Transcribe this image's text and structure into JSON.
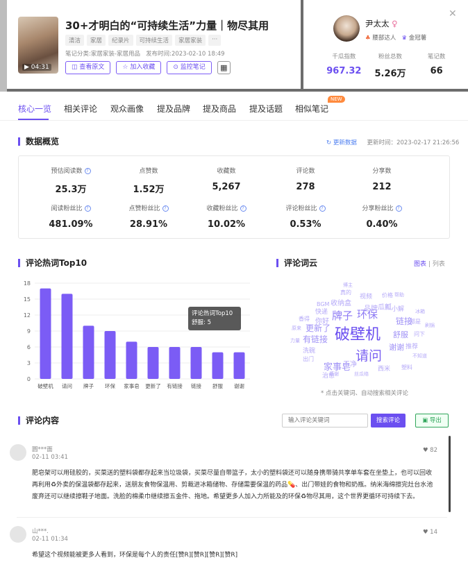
{
  "note": {
    "duration": "04:31",
    "title": "30+才明白的“可持续生活”力量｜物尽其用",
    "tags": [
      "清洁",
      "家居",
      "纪录片",
      "可持续生活",
      "家居家装",
      "···"
    ],
    "category_label": "笔记分类:",
    "category": "家居家装-家居用品",
    "publish_label": "发布时间:",
    "publish_time": "2023-02-10 18:49",
    "actions": [
      "查看原文",
      "加入收藏",
      "监控笔记"
    ],
    "qr_icon": "qr-code-icon"
  },
  "author": {
    "name": "尹太太",
    "gender_icon": "♀",
    "badge1": "腰部达人",
    "badge2": "金冠薯",
    "stats": [
      {
        "label": "千瓜指数",
        "value": "967.32"
      },
      {
        "label": "粉丝总数",
        "value": "5.26万"
      },
      {
        "label": "笔记数",
        "value": "66"
      }
    ]
  },
  "tabs": [
    "核心一览",
    "相关评论",
    "观众画像",
    "提及品牌",
    "提及商品",
    "提及话题",
    "相似笔记"
  ],
  "new_badge": "NEW",
  "overview": {
    "title": "数据概览",
    "refresh": "更新数据",
    "update_label": "更新时间：",
    "update_time": "2023-02-17 21:26:56",
    "row1": [
      {
        "label": "预估阅读数",
        "value": "25.3万",
        "help": true
      },
      {
        "label": "点赞数",
        "value": "1.52万",
        "help": false
      },
      {
        "label": "收藏数",
        "value": "5,267",
        "help": false
      },
      {
        "label": "评论数",
        "value": "278",
        "help": false
      },
      {
        "label": "分享数",
        "value": "212",
        "help": false
      }
    ],
    "row2": [
      {
        "label": "阅读粉丝比",
        "value": "481.09%",
        "help": true
      },
      {
        "label": "点赞粉丝比",
        "value": "28.91%",
        "help": true
      },
      {
        "label": "收藏粉丝比",
        "value": "10.02%",
        "help": true
      },
      {
        "label": "评论粉丝比",
        "value": "0.53%",
        "help": true
      },
      {
        "label": "分享粉丝比",
        "value": "0.40%",
        "help": true
      }
    ]
  },
  "hotwords": {
    "title": "评论热词Top10",
    "tooltip_title": "评论热词Top10",
    "tooltip_value": "舒服: 5"
  },
  "chart_data": {
    "type": "bar",
    "title": "评论热词Top10",
    "categories": [
      "破壁机",
      "请问",
      "牌子",
      "环保",
      "家事皂",
      "更新了",
      "有链接",
      "链接",
      "舒服",
      "谢谢"
    ],
    "values": [
      17,
      16,
      10,
      9,
      7,
      6,
      6,
      6,
      5,
      5
    ],
    "ylim": [
      0,
      18
    ],
    "yticks": [
      0,
      3,
      6,
      9,
      12,
      15,
      18
    ],
    "grid": true,
    "color": "#7b5cf5"
  },
  "wordcloud": {
    "title": "评论词云",
    "view_chart": "图表",
    "view_sep": "|",
    "view_list": "列表",
    "note": "* 点击关键词、自动搜索相关评论",
    "words": [
      "破壁机",
      "请问",
      "牌子",
      "环保",
      "家事皂",
      "有链接",
      "更新了",
      "链接",
      "舒服",
      "谢谢",
      "品牌",
      "瓜瓤",
      "小解",
      "收纳盒",
      "快递",
      "你好",
      "视频",
      "价格",
      "干净",
      "推荐",
      "真的",
      "治愈",
      "洗碗",
      "出门",
      "香得",
      "不知道",
      "都是",
      "问下",
      "力量",
      "西米",
      "冰箱",
      "BGM",
      "博主",
      "感谢",
      "刷锅",
      "塑料",
      "丝瓜络",
      "帮助",
      "原来"
    ]
  },
  "comments": {
    "title": "评论内容",
    "search_placeholder": "输入评论关键词",
    "search_button": "搜索评论",
    "export_button": "导出",
    "items": [
      {
        "name": "圆***面",
        "time": "02-11 03:41",
        "likes": "82",
        "text": "肥皂架可以用硅胶的，买菜送的塑料袋都存起来当垃圾袋，买菜尽量自带篮子，太小的塑料袋还可以随身携带骑共享单车套在坐垫上，也可以回收再利用♻外卖的保温袋都存起来，送朋友食物保温用、剪裁进冰箱储物、存储需要保温的药品💊、出门带娃的食物和奶瓶。纳米海绵擦完灶台水池废弃还可以继续擦鞋子地面。洗脸的棉柔巾继续擦五金件、拖地。希望更多人加入力所能及的环保♻物尽其用，这个世界更循环可持续下去。"
      },
      {
        "name": "山***.",
        "time": "02-11 01:34",
        "likes": "14",
        "text": "希望这个视频能被更多人看到，环保是每个人的责任[赞R][赞R][赞R][赞R]"
      }
    ]
  }
}
